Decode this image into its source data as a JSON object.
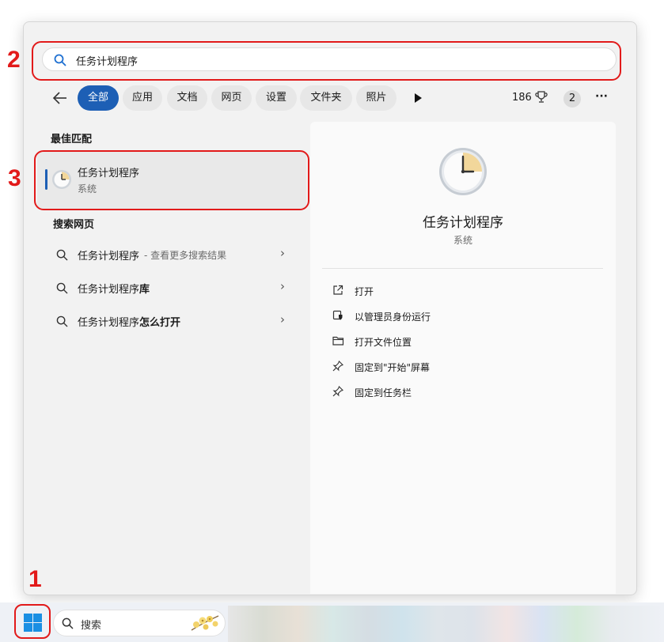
{
  "annotations": [
    "1",
    "2",
    "3"
  ],
  "search": {
    "query": "任务计划程序"
  },
  "filters": {
    "tabs": [
      "全部",
      "应用",
      "文档",
      "网页",
      "设置",
      "文件夹",
      "照片"
    ],
    "active": "全部",
    "points": "186",
    "badge": "2",
    "more": "···"
  },
  "best_match": {
    "heading": "最佳匹配",
    "title": "任务计划程序",
    "subtitle": "系统"
  },
  "web": {
    "heading": "搜索网页",
    "items": [
      {
        "main": "任务计划程序",
        "suffix": " - 查看更多搜索结果"
      },
      {
        "main": "任务计划程序",
        "suffix": "库"
      },
      {
        "main": "任务计划程序",
        "suffix": "怎么打开"
      }
    ]
  },
  "detail": {
    "title": "任务计划程序",
    "subtitle": "系统",
    "actions": [
      "打开",
      "以管理员身份运行",
      "打开文件位置",
      "固定到\"开始\"屏幕",
      "固定到任务栏"
    ],
    "action_icons": [
      "open-external-icon",
      "shield-admin-icon",
      "folder-icon",
      "pin-icon",
      "pin-icon"
    ]
  },
  "taskbar": {
    "search_placeholder": "搜索"
  },
  "colors": {
    "accent": "#1d5fb5",
    "annotation": "#e21a1a"
  }
}
